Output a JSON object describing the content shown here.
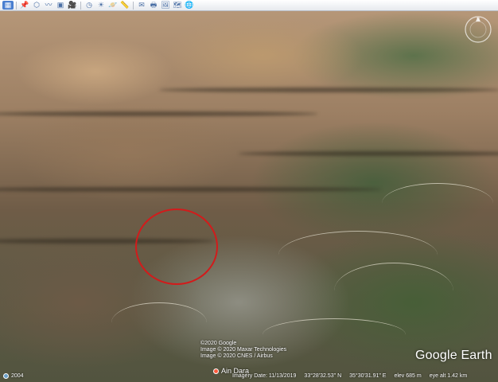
{
  "app": {
    "name": "Google Earth"
  },
  "toolbar": {
    "buttons": [
      {
        "name": "sidebar-toggle-button",
        "icon": "sidebar-icon",
        "glyph": "▦",
        "active": true
      },
      {
        "name": "placemark-button",
        "icon": "pin-icon",
        "glyph": "📌"
      },
      {
        "name": "polygon-button",
        "icon": "polygon-icon",
        "glyph": "⬡"
      },
      {
        "name": "path-button",
        "icon": "path-icon",
        "glyph": "〰"
      },
      {
        "name": "image-overlay-button",
        "icon": "overlay-icon",
        "glyph": "▣"
      },
      {
        "name": "record-tour-button",
        "icon": "camera-icon",
        "glyph": "🎥"
      },
      {
        "name": "historical-imagery-button",
        "icon": "clock-icon",
        "glyph": "◷"
      },
      {
        "name": "sunlight-button",
        "icon": "sun-icon",
        "glyph": "☀"
      },
      {
        "name": "planets-button",
        "icon": "planet-icon",
        "glyph": "🪐"
      },
      {
        "name": "ruler-button",
        "icon": "ruler-icon",
        "glyph": "📏"
      },
      {
        "name": "email-button",
        "icon": "email-icon",
        "glyph": "✉"
      },
      {
        "name": "print-button",
        "icon": "print-icon",
        "glyph": "🖶"
      },
      {
        "name": "save-image-button",
        "icon": "save-image-icon",
        "glyph": "🖼"
      },
      {
        "name": "view-in-maps-button",
        "icon": "maps-icon",
        "glyph": "🗺"
      },
      {
        "name": "earth-button",
        "icon": "globe-icon",
        "glyph": "🌐"
      }
    ]
  },
  "map": {
    "annotation_color": "#d21b1b",
    "attribution": [
      "©2020 Google",
      "Image © 2020 Maxar Technologies",
      "Image © 2020 CNES / Airbus"
    ],
    "place_label": "Ain Dara",
    "logo": "Google Earth"
  },
  "status": {
    "time_slider_year": "2004",
    "imagery_date": "Imagery Date: 11/13/2019",
    "latitude": "33°28'32.53\" N",
    "longitude": "35°30'31.91\" E",
    "elevation": "elev  685 m",
    "eye_alt": "eye alt  1.42 km"
  }
}
